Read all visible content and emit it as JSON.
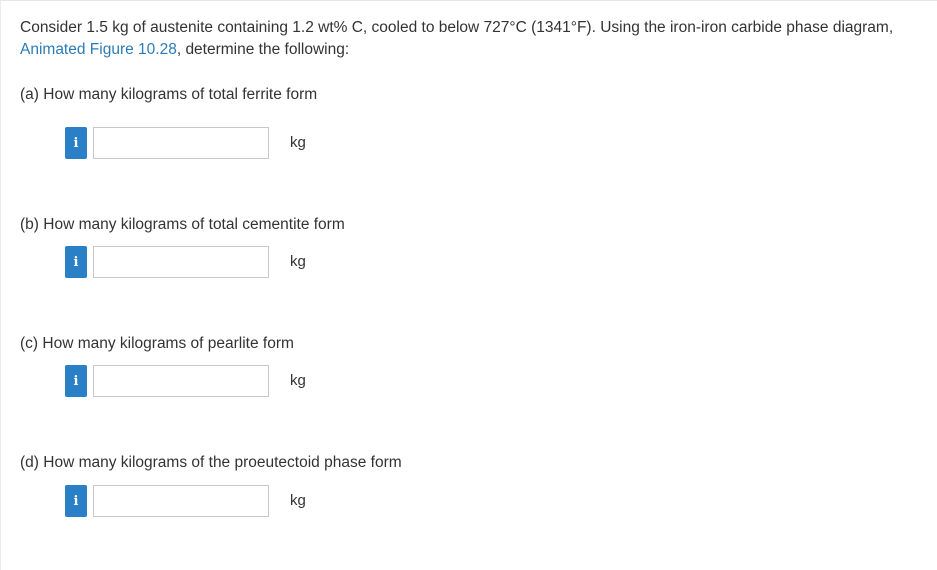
{
  "intro": {
    "text_before": "Consider 1.5 kg of austenite containing 1.2 wt% C, cooled to below 727°C (1341°F). Using the iron-iron carbide phase diagram, ",
    "link_text": "Animated Figure 10.28",
    "text_after": ", determine the following:"
  },
  "questions": [
    {
      "label": "(a) How many kilograms of total ferrite form",
      "value": "",
      "unit": "kg",
      "info_glyph": "i"
    },
    {
      "label": "(b) How many kilograms of total cementite form",
      "value": "",
      "unit": "kg",
      "info_glyph": "i"
    },
    {
      "label": "(c) How many kilograms of pearlite form",
      "value": "",
      "unit": "kg",
      "info_glyph": "i"
    },
    {
      "label": "(d) How many kilograms of the proeutectoid phase form",
      "value": "",
      "unit": "kg",
      "info_glyph": "i"
    }
  ],
  "colors": {
    "info_button": "#2a80c7",
    "link": "#2b7bb9",
    "text": "#333333"
  },
  "icons": {
    "info": "info-icon"
  }
}
